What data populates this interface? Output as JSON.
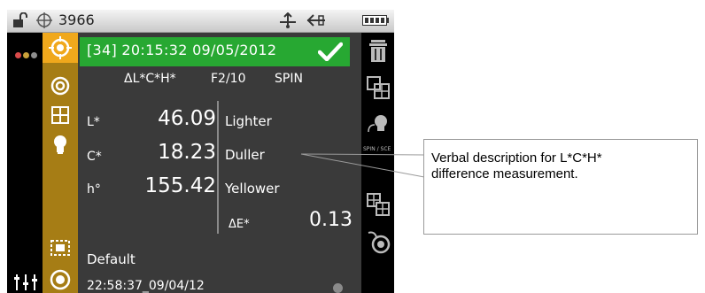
{
  "status_bar": {
    "count": "3966"
  },
  "header": {
    "title": "[34] 20:15:32 09/05/2012"
  },
  "subheader": {
    "mode": "ΔL*C*H*",
    "illuminant": "F2/10",
    "spin": "SPIN"
  },
  "measurements": [
    {
      "label": "L*",
      "value": "46.09",
      "description": "Lighter"
    },
    {
      "label": "C*",
      "value": "18.23",
      "description": "Duller"
    },
    {
      "label": "h°",
      "value": "155.42",
      "description": "Yellower"
    }
  ],
  "delta_e": {
    "label": "ΔE*",
    "value": "0.13"
  },
  "standard": {
    "name": "Default",
    "timestamp": "22:58:37_09/04/12"
  },
  "right_bar": {
    "tiny_label": "SPIN / SCE"
  },
  "callout": {
    "line1": "Verbal description for L*C*H*",
    "line2": "difference measurement."
  },
  "colors": {
    "header_green": "#27a832",
    "sidebar_gold": "#a67d15",
    "active_orange": "#f0a81c",
    "panel_gray": "#3a3a3a",
    "dot_colors": [
      "#d94a4a",
      "#c9a13a",
      "#8e8e8e"
    ]
  }
}
